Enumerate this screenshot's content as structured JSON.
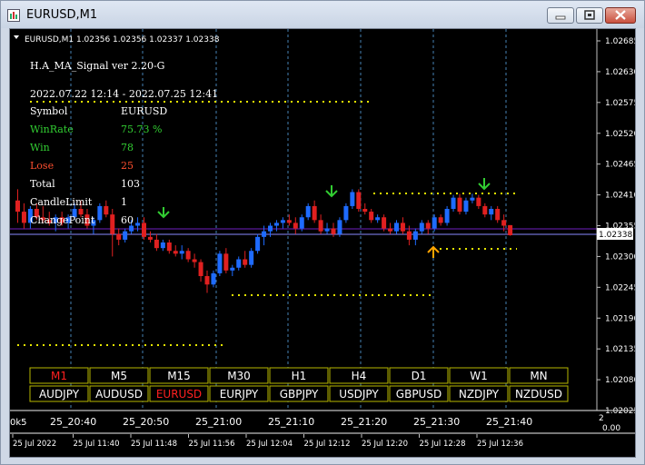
{
  "window": {
    "title": "EURUSD,M1"
  },
  "chart_header": "EURUSD,M1  1.02356 1.02356 1.02337 1.02338",
  "info_panel": {
    "indicator_title": "H.A_MA_Signal ver 2.20-G",
    "date_range": "2022.07.22 12:14 - 2022.07.25 12:41",
    "rows": [
      {
        "label": "Symbol",
        "value": "EURUSD",
        "color": "#ffffff"
      },
      {
        "label": "WinRate",
        "value": "75.73 %",
        "color": "#32cd32"
      },
      {
        "label": "Win",
        "value": "78",
        "color": "#32cd32"
      },
      {
        "label": "Lose",
        "value": "25",
        "color": "#ff4f2f"
      },
      {
        "label": "Total",
        "value": "103",
        "color": "#ffffff"
      },
      {
        "label": "CandleLimit",
        "value": "1",
        "color": "#ffffff"
      },
      {
        "label": "ChangePoint",
        "value": "60",
        "color": "#ffffff"
      }
    ]
  },
  "timeframe_buttons": [
    "M1",
    "M5",
    "M15",
    "M30",
    "H1",
    "H4",
    "D1",
    "W1",
    "MN"
  ],
  "active_timeframe": "M1",
  "symbol_buttons": [
    "AUDJPY",
    "AUDUSD",
    "EURUSD",
    "EURJPY",
    "GBPJPY",
    "USDJPY",
    "GBPUSD",
    "NZDJPY",
    "NZDUSD"
  ],
  "active_symbol": "EURUSD",
  "price_axis": [
    "1.02685",
    "1.02630",
    "1.02575",
    "1.02520",
    "1.02465",
    "1.02410",
    "1.02355",
    "1.02300",
    "1.02245",
    "1.02190",
    "1.02135",
    "1.02080",
    "1.02025"
  ],
  "current_price": "1.02338",
  "subwindow": {
    "left_label": "0k5",
    "times": [
      "25_20:40",
      "25_20:50",
      "25_21:00",
      "25_21:10",
      "25_21:20",
      "25_21:30",
      "25_21:40"
    ],
    "right_top": "2",
    "right_bottom": "0.00"
  },
  "time_axis": [
    "25 Jul 2022",
    "25 Jul 11:40",
    "25 Jul 11:48",
    "25 Jul 11:56",
    "25 Jul 12:04",
    "25 Jul 12:12",
    "25 Jul 12:20",
    "25 Jul 12:28",
    "25 Jul 12:36"
  ],
  "colors": {
    "bull": "#1e6bff",
    "bear": "#e02020",
    "buy_arrow": "#32cd32",
    "sell_arrow": "#ffa500",
    "dotted_level": "#e6e600",
    "grid": "#4682b4",
    "active_button_text": "#ff2020",
    "button_border": "#b8b800",
    "current_price_line": "#8a8aff",
    "purple_line": "#5a1a9a"
  },
  "candles": [
    {
      "o": 1.024,
      "h": 1.0242,
      "l": 1.0236,
      "c": 1.0238
    },
    {
      "o": 1.0238,
      "h": 1.02395,
      "l": 1.0235,
      "c": 1.0236
    },
    {
      "o": 1.0236,
      "h": 1.0239,
      "l": 1.0235,
      "c": 1.02385
    },
    {
      "o": 1.02385,
      "h": 1.02395,
      "l": 1.02365,
      "c": 1.0237
    },
    {
      "o": 1.0237,
      "h": 1.0239,
      "l": 1.0236,
      "c": 1.02365
    },
    {
      "o": 1.02365,
      "h": 1.0238,
      "l": 1.02355,
      "c": 1.0236
    },
    {
      "o": 1.0236,
      "h": 1.02375,
      "l": 1.02345,
      "c": 1.0237
    },
    {
      "o": 1.0237,
      "h": 1.0238,
      "l": 1.02355,
      "c": 1.0236
    },
    {
      "o": 1.0236,
      "h": 1.02375,
      "l": 1.0235,
      "c": 1.0237
    },
    {
      "o": 1.0237,
      "h": 1.02395,
      "l": 1.02365,
      "c": 1.02385
    },
    {
      "o": 1.02385,
      "h": 1.024,
      "l": 1.0237,
      "c": 1.02375
    },
    {
      "o": 1.02375,
      "h": 1.02385,
      "l": 1.0235,
      "c": 1.02355
    },
    {
      "o": 1.02355,
      "h": 1.0237,
      "l": 1.0234,
      "c": 1.02365
    },
    {
      "o": 1.02365,
      "h": 1.02395,
      "l": 1.0236,
      "c": 1.0239
    },
    {
      "o": 1.0239,
      "h": 1.024,
      "l": 1.0237,
      "c": 1.02375
    },
    {
      "o": 1.02375,
      "h": 1.02385,
      "l": 1.023,
      "c": 1.0234
    },
    {
      "o": 1.0234,
      "h": 1.0235,
      "l": 1.0232,
      "c": 1.0233
    },
    {
      "o": 1.0233,
      "h": 1.0235,
      "l": 1.02325,
      "c": 1.02345
    },
    {
      "o": 1.02345,
      "h": 1.02365,
      "l": 1.0234,
      "c": 1.02355
    },
    {
      "o": 1.02355,
      "h": 1.0237,
      "l": 1.02345,
      "c": 1.0236
    },
    {
      "o": 1.0236,
      "h": 1.0237,
      "l": 1.0233,
      "c": 1.02335
    },
    {
      "o": 1.02335,
      "h": 1.02345,
      "l": 1.02325,
      "c": 1.0233
    },
    {
      "o": 1.0233,
      "h": 1.0234,
      "l": 1.0231,
      "c": 1.02315
    },
    {
      "o": 1.02315,
      "h": 1.0233,
      "l": 1.0231,
      "c": 1.02325
    },
    {
      "o": 1.02325,
      "h": 1.0233,
      "l": 1.02305,
      "c": 1.0231
    },
    {
      "o": 1.0231,
      "h": 1.0232,
      "l": 1.023,
      "c": 1.02305
    },
    {
      "o": 1.02305,
      "h": 1.0232,
      "l": 1.02295,
      "c": 1.0231
    },
    {
      "o": 1.0231,
      "h": 1.02315,
      "l": 1.0229,
      "c": 1.02295
    },
    {
      "o": 1.02295,
      "h": 1.02305,
      "l": 1.0228,
      "c": 1.0229
    },
    {
      "o": 1.0229,
      "h": 1.02295,
      "l": 1.02255,
      "c": 1.02265
    },
    {
      "o": 1.02265,
      "h": 1.02275,
      "l": 1.02235,
      "c": 1.0225
    },
    {
      "o": 1.0225,
      "h": 1.02275,
      "l": 1.02245,
      "c": 1.0227
    },
    {
      "o": 1.0227,
      "h": 1.0231,
      "l": 1.02265,
      "c": 1.02305
    },
    {
      "o": 1.02305,
      "h": 1.02315,
      "l": 1.0227,
      "c": 1.02275
    },
    {
      "o": 1.02275,
      "h": 1.02285,
      "l": 1.02265,
      "c": 1.0228
    },
    {
      "o": 1.0228,
      "h": 1.023,
      "l": 1.02275,
      "c": 1.02295
    },
    {
      "o": 1.02295,
      "h": 1.0231,
      "l": 1.0228,
      "c": 1.02285
    },
    {
      "o": 1.02285,
      "h": 1.02315,
      "l": 1.0228,
      "c": 1.0231
    },
    {
      "o": 1.0231,
      "h": 1.0234,
      "l": 1.02305,
      "c": 1.02335
    },
    {
      "o": 1.02335,
      "h": 1.02355,
      "l": 1.0232,
      "c": 1.02345
    },
    {
      "o": 1.02345,
      "h": 1.0236,
      "l": 1.02335,
      "c": 1.02355
    },
    {
      "o": 1.02355,
      "h": 1.02365,
      "l": 1.02345,
      "c": 1.0236
    },
    {
      "o": 1.0236,
      "h": 1.0237,
      "l": 1.0235,
      "c": 1.02365
    },
    {
      "o": 1.02365,
      "h": 1.02375,
      "l": 1.02355,
      "c": 1.0236
    },
    {
      "o": 1.0236,
      "h": 1.0237,
      "l": 1.0234,
      "c": 1.0235
    },
    {
      "o": 1.0235,
      "h": 1.02375,
      "l": 1.02345,
      "c": 1.0237
    },
    {
      "o": 1.0237,
      "h": 1.02395,
      "l": 1.02365,
      "c": 1.0239
    },
    {
      "o": 1.0239,
      "h": 1.024,
      "l": 1.0236,
      "c": 1.02365
    },
    {
      "o": 1.02365,
      "h": 1.02375,
      "l": 1.0234,
      "c": 1.02345
    },
    {
      "o": 1.02345,
      "h": 1.0236,
      "l": 1.0234,
      "c": 1.0235
    },
    {
      "o": 1.0235,
      "h": 1.0236,
      "l": 1.02335,
      "c": 1.0234
    },
    {
      "o": 1.0234,
      "h": 1.0237,
      "l": 1.02335,
      "c": 1.02365
    },
    {
      "o": 1.02365,
      "h": 1.02395,
      "l": 1.0236,
      "c": 1.0239
    },
    {
      "o": 1.0239,
      "h": 1.0242,
      "l": 1.02385,
      "c": 1.02415
    },
    {
      "o": 1.02415,
      "h": 1.0242,
      "l": 1.0238,
      "c": 1.02385
    },
    {
      "o": 1.02385,
      "h": 1.02395,
      "l": 1.02375,
      "c": 1.0238
    },
    {
      "o": 1.0238,
      "h": 1.02385,
      "l": 1.0236,
      "c": 1.02365
    },
    {
      "o": 1.02365,
      "h": 1.02375,
      "l": 1.0236,
      "c": 1.0237
    },
    {
      "o": 1.0237,
      "h": 1.02375,
      "l": 1.02345,
      "c": 1.0235
    },
    {
      "o": 1.0235,
      "h": 1.0236,
      "l": 1.0234,
      "c": 1.02345
    },
    {
      "o": 1.02345,
      "h": 1.02365,
      "l": 1.0234,
      "c": 1.0236
    },
    {
      "o": 1.0236,
      "h": 1.0237,
      "l": 1.0234,
      "c": 1.02345
    },
    {
      "o": 1.02345,
      "h": 1.02355,
      "l": 1.0232,
      "c": 1.0233
    },
    {
      "o": 1.0233,
      "h": 1.0235,
      "l": 1.0232,
      "c": 1.02345
    },
    {
      "o": 1.02345,
      "h": 1.02365,
      "l": 1.0234,
      "c": 1.0236
    },
    {
      "o": 1.0236,
      "h": 1.02365,
      "l": 1.0234,
      "c": 1.0235
    },
    {
      "o": 1.0235,
      "h": 1.02375,
      "l": 1.02345,
      "c": 1.0237
    },
    {
      "o": 1.0237,
      "h": 1.02375,
      "l": 1.02355,
      "c": 1.0236
    },
    {
      "o": 1.0236,
      "h": 1.0239,
      "l": 1.02355,
      "c": 1.02385
    },
    {
      "o": 1.02385,
      "h": 1.0241,
      "l": 1.0238,
      "c": 1.02405
    },
    {
      "o": 1.02405,
      "h": 1.02412,
      "l": 1.02375,
      "c": 1.0238
    },
    {
      "o": 1.0238,
      "h": 1.02405,
      "l": 1.02375,
      "c": 1.024
    },
    {
      "o": 1.024,
      "h": 1.02412,
      "l": 1.02395,
      "c": 1.02405
    },
    {
      "o": 1.02405,
      "h": 1.0241,
      "l": 1.02385,
      "c": 1.0239
    },
    {
      "o": 1.0239,
      "h": 1.02395,
      "l": 1.0237,
      "c": 1.02375
    },
    {
      "o": 1.02375,
      "h": 1.0239,
      "l": 1.02365,
      "c": 1.02385
    },
    {
      "o": 1.02385,
      "h": 1.0239,
      "l": 1.0236,
      "c": 1.02365
    },
    {
      "o": 1.02365,
      "h": 1.02375,
      "l": 1.02345,
      "c": 1.02355
    },
    {
      "o": 1.02356,
      "h": 1.02356,
      "l": 1.02337,
      "c": 1.02338
    }
  ]
}
